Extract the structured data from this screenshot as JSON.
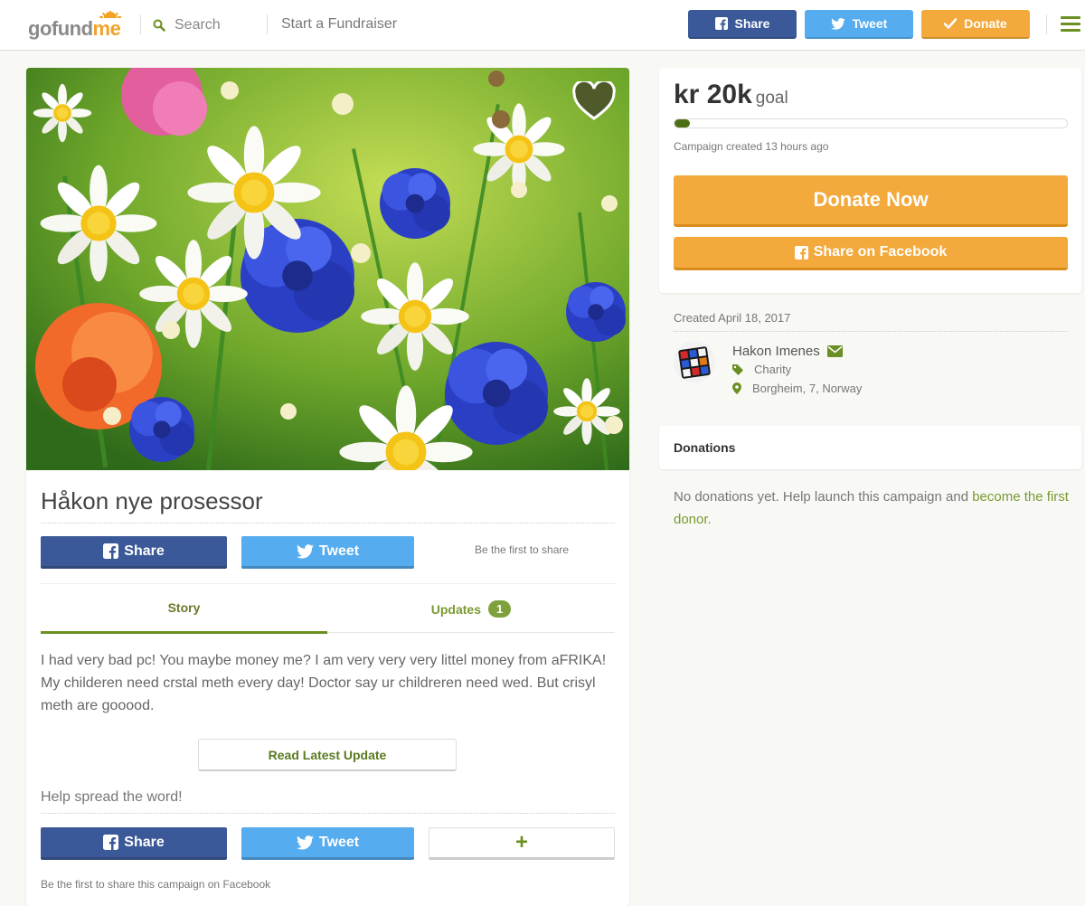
{
  "header": {
    "logo_go": "gofund",
    "logo_me": "me",
    "search_label": "Search",
    "start_label": "Start a Fundraiser",
    "share_label": "Share",
    "tweet_label": "Tweet",
    "donate_label": "Donate"
  },
  "campaign": {
    "title": "Håkon nye prosessor",
    "share_label": "Share",
    "tweet_label": "Tweet",
    "first_share": "Be the first to share",
    "tabs": {
      "story": "Story",
      "updates": "Updates",
      "updates_count": "1"
    },
    "story_text": "I had very bad pc! You maybe money me? I am very very very littel money from aFRIKA! My childeren need crstal meth every day! Doctor say ur childreren need wed. But crisyl meth are gooood.",
    "read_update": "Read Latest Update",
    "spread": "Help spread the word!",
    "plus": "+",
    "first_fb": "Be the first to share this campaign on Facebook"
  },
  "goal": {
    "amount": "kr 20k",
    "goal_word": "goal",
    "progress_fraction": 0.04,
    "created_ago": "Campaign created 13 hours ago",
    "donate_now": "Donate Now",
    "share_facebook": "Share on Facebook"
  },
  "organizer": {
    "created_date": "Created April 18, 2017",
    "name": "Hakon Imenes",
    "category": "Charity",
    "location": "Borgheim, 7, Norway"
  },
  "donations": {
    "heading": "Donations",
    "empty_text": "No donations yet. Help launch this campaign and ",
    "empty_link": "become the first donor."
  },
  "colors": {
    "facebook": "#3b5998",
    "twitter": "#55acee",
    "donate": "#f3a93b",
    "accent_green": "#6a8f23"
  }
}
